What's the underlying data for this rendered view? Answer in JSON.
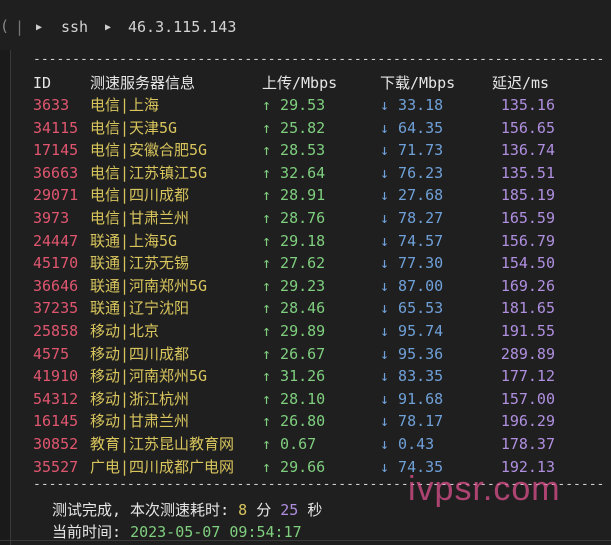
{
  "topbar": {
    "separator": "|",
    "breadcrumb": [
      "ssh",
      "46.3.115.143"
    ]
  },
  "table": {
    "separator_line": "--------------------------------------------------------------------------",
    "headers": {
      "id": "ID",
      "server": "测速服务器信息",
      "upload": "上传/Mbps",
      "download": "下载/Mbps",
      "latency": "延迟/ms"
    },
    "rows": [
      {
        "id": "3633",
        "server": "电信|上海",
        "upload": "↑ 29.53",
        "download": "↓ 33.18",
        "latency": "135.16"
      },
      {
        "id": "34115",
        "server": "电信|天津5G",
        "upload": "↑ 25.82",
        "download": "↓ 64.35",
        "latency": "156.65"
      },
      {
        "id": "17145",
        "server": "电信|安徽合肥5G",
        "upload": "↑ 28.53",
        "download": "↓ 71.73",
        "latency": "136.74"
      },
      {
        "id": "36663",
        "server": "电信|江苏镇江5G",
        "upload": "↑ 32.64",
        "download": "↓ 76.23",
        "latency": "135.51"
      },
      {
        "id": "29071",
        "server": "电信|四川成都",
        "upload": "↑ 28.91",
        "download": "↓ 27.68",
        "latency": "185.19"
      },
      {
        "id": "3973",
        "server": "电信|甘肃兰州",
        "upload": "↑ 28.76",
        "download": "↓ 78.27",
        "latency": "165.59"
      },
      {
        "id": "24447",
        "server": "联通|上海5G",
        "upload": "↑ 29.18",
        "download": "↓ 74.57",
        "latency": "156.79"
      },
      {
        "id": "45170",
        "server": "联通|江苏无锡",
        "upload": "↑ 27.62",
        "download": "↓ 77.30",
        "latency": "154.50"
      },
      {
        "id": "36646",
        "server": "联通|河南郑州5G",
        "upload": "↑ 29.23",
        "download": "↓ 87.00",
        "latency": "169.26"
      },
      {
        "id": "37235",
        "server": "联通|辽宁沈阳",
        "upload": "↑ 28.46",
        "download": "↓ 65.53",
        "latency": "181.65"
      },
      {
        "id": "25858",
        "server": "移动|北京",
        "upload": "↑ 29.89",
        "download": "↓ 95.74",
        "latency": "191.55"
      },
      {
        "id": "4575",
        "server": "移动|四川成都",
        "upload": "↑ 26.67",
        "download": "↓ 95.36",
        "latency": "289.89"
      },
      {
        "id": "41910",
        "server": "移动|河南郑州5G",
        "upload": "↑ 31.26",
        "download": "↓ 83.35",
        "latency": "177.12"
      },
      {
        "id": "54312",
        "server": "移动|浙江杭州",
        "upload": "↑ 28.10",
        "download": "↓ 91.68",
        "latency": "157.00"
      },
      {
        "id": "16145",
        "server": "移动|甘肃兰州",
        "upload": "↑ 26.80",
        "download": "↓ 78.17",
        "latency": "196.29"
      },
      {
        "id": "30852",
        "server": "教育|江苏昆山教育网",
        "upload": "↑ 0.67",
        "download": "↓ 0.43",
        "latency": "178.37"
      },
      {
        "id": "35527",
        "server": "广电|四川成都广电网",
        "upload": "↑ 29.66",
        "download": "↓ 74.35",
        "latency": "192.13"
      }
    ]
  },
  "summary": {
    "done_prefix": "测试完成, 本次测速耗时:",
    "minutes": "8",
    "minutes_unit": "分",
    "seconds": "25",
    "seconds_unit": "秒",
    "time_label": "当前时间:",
    "time_value": "2023-05-07 09:54:17"
  },
  "watermark": "ivpsr.com",
  "colors": {
    "background": "#1f1f1f",
    "id": "#e0566f",
    "server": "#d8c55d",
    "upload": "#7fcf7f",
    "download": "#6fa0d8",
    "latency": "#b08fe0"
  }
}
